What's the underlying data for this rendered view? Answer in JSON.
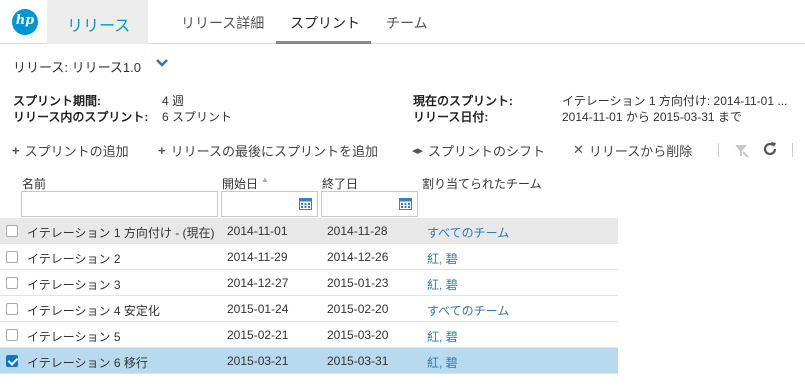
{
  "nav": {
    "logo": "hp",
    "app_tab": "リリース",
    "tabs": [
      "リリース詳細",
      "スプリント",
      "チーム"
    ],
    "active_tab": "スプリント"
  },
  "release": {
    "label": "リリース: リリース1.0"
  },
  "info": {
    "sprint_period_label": "スプリント期間:",
    "sprint_period_value": "4 週",
    "sprints_in_release_label": "リリース内のスプリント:",
    "sprints_in_release_value": "6 スプリント",
    "current_sprint_label": "現在のスプリント:",
    "current_sprint_value": "イテレーション 1 方向付け: 2014-11-01 ...",
    "release_date_label": "リリース日付:",
    "release_date_value": "2014-11-01 から 2015-03-31 まで"
  },
  "toolbar": {
    "add_sprint": "スプリントの追加",
    "add_sprint_end": "リリースの最後にスプリントを追加",
    "shift_sprint": "スプリントのシフト",
    "remove": "リリースから削除"
  },
  "grid": {
    "columns": [
      "名前",
      "開始日",
      "終了日",
      "割り当てられたチーム"
    ],
    "rows": [
      {
        "name": "イテレーション 1 方向付け - (現在)",
        "start": "2014-11-01",
        "end": "2014-11-28",
        "team": "すべてのチーム",
        "checked": false,
        "state": "current"
      },
      {
        "name": "イテレーション 2",
        "start": "2014-11-29",
        "end": "2014-12-26",
        "team": "紅, 碧",
        "checked": false,
        "state": "normal"
      },
      {
        "name": "イテレーション 3",
        "start": "2014-12-27",
        "end": "2015-01-23",
        "team": "紅, 碧",
        "checked": false,
        "state": "normal"
      },
      {
        "name": "イテレーション 4 安定化",
        "start": "2015-01-24",
        "end": "2015-02-20",
        "team": "すべてのチーム",
        "checked": false,
        "state": "normal"
      },
      {
        "name": "イテレーション 5",
        "start": "2015-02-21",
        "end": "2015-03-20",
        "team": "紅, 碧",
        "checked": false,
        "state": "normal"
      },
      {
        "name": "イテレーション 6 移行",
        "start": "2015-03-21",
        "end": "2015-03-31",
        "team": "紅, 碧",
        "checked": true,
        "state": "selected"
      }
    ]
  }
}
